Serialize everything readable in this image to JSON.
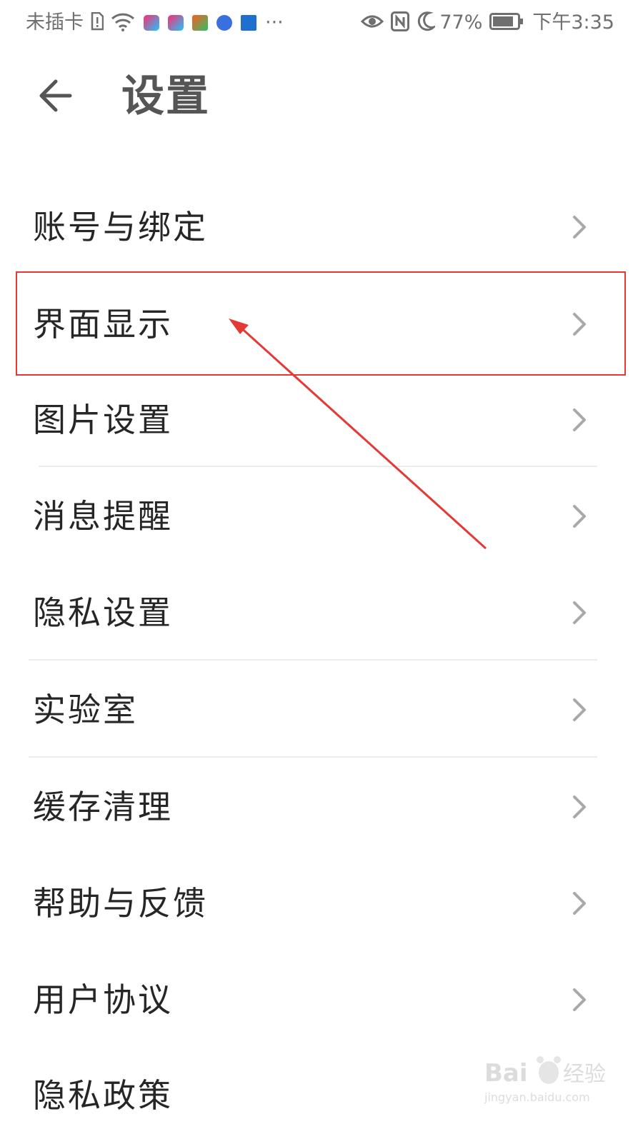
{
  "status": {
    "carrier": "未插卡",
    "battery": "77%",
    "time": "下午3:35",
    "icons": [
      "sim-error-icon",
      "wifi-icon",
      "youku-app-icon",
      "youku-app-icon",
      "app-icon",
      "music-app-icon",
      "app-icon",
      "more-icon",
      "eye-comfort-icon",
      "nfc-icon",
      "moon-icon",
      "battery-icon"
    ]
  },
  "header": {
    "title": "设置",
    "back_icon": "back-arrow-icon"
  },
  "settings": {
    "items": [
      {
        "label": "账号与绑定"
      },
      {
        "label": "界面显示"
      },
      {
        "label": "图片设置"
      },
      {
        "label": "消息提醒"
      },
      {
        "label": "隐私设置"
      },
      {
        "label": "实验室"
      },
      {
        "label": "缓存清理"
      },
      {
        "label": "帮助与反馈"
      },
      {
        "label": "用户协议"
      },
      {
        "label": "隐私政策"
      }
    ]
  },
  "annotation": {
    "color": "#e53935",
    "highlighted_item": "界面显示"
  },
  "watermark": {
    "brand": "Bai 经验",
    "url": "jingyan.baidu.com"
  }
}
